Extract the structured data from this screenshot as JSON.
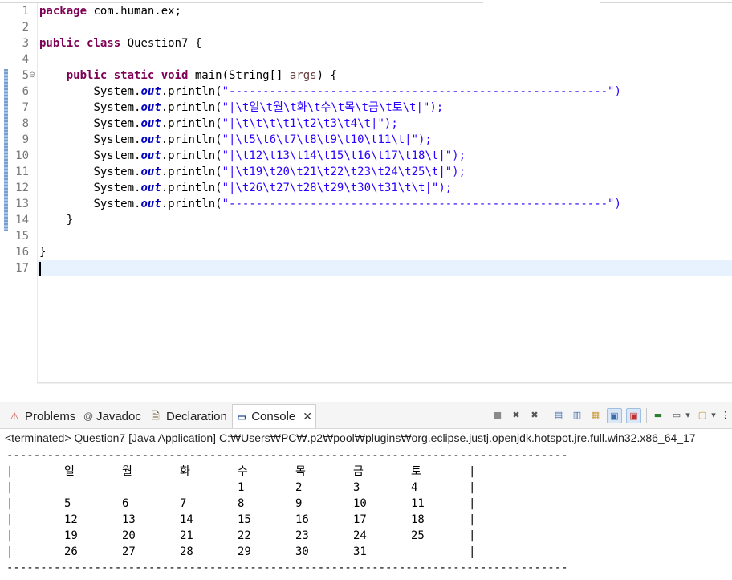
{
  "editor": {
    "line_numbers": [
      "1",
      "2",
      "3",
      "4",
      "5",
      "6",
      "7",
      "8",
      "9",
      "10",
      "11",
      "12",
      "13",
      "14",
      "15",
      "16",
      "17"
    ],
    "fold_marker": "⊖",
    "package_kw": "package",
    "package_name": " com.human.ex;",
    "class_kw": "public class",
    "class_name": " Question7 {",
    "method_kw": "public static void",
    "method_sig": " main(String[] ",
    "method_param": "args",
    "method_end": ") {",
    "sysout_prefix": "System.",
    "sysout_field": "out",
    "sysout_call": ".println(",
    "print_strings": [
      "\"--------------------------------------------------------\")",
      "\"|\\t일\\t월\\t화\\t수\\t목\\t금\\t토\\t|\");",
      "\"|\\t\\t\\t\\t1\\t2\\t3\\t4\\t|\");",
      "\"|\\t5\\t6\\t7\\t8\\t9\\t10\\t11\\t|\");",
      "\"|\\t12\\t13\\t14\\t15\\t16\\t17\\t18\\t|\");",
      "\"|\\t19\\t20\\t21\\t22\\t23\\t24\\t25\\t|\");",
      "\"|\\t26\\t27\\t28\\t29\\t30\\t31\\t\\t|\");",
      "\"--------------------------------------------------------\")"
    ],
    "close_method": "}",
    "close_class": "}"
  },
  "scrollbar": {
    "left_arrow": "<",
    "right_arrow": ">"
  },
  "views": {
    "tabs": [
      {
        "label": "Problems",
        "icon": "problems-icon",
        "glyph": "⚠"
      },
      {
        "label": "Javadoc",
        "icon": "javadoc-icon",
        "glyph": "@"
      },
      {
        "label": "Declaration",
        "icon": "declaration-icon",
        "glyph": "🗎"
      },
      {
        "label": "Console",
        "icon": "console-icon",
        "glyph": "▭"
      }
    ],
    "close_glyph": "✕",
    "status": "<terminated> Question7 [Java Application] C:₩Users₩PC₩.p2₩pool₩plugins₩org.eclipse.justj.openjdk.hotspot.jre.full.win32.x86_64_17"
  },
  "console": {
    "separator": "-----------------------------------------------------------------------------------",
    "bar": "|",
    "rows": [
      [
        "일",
        "월",
        "화",
        "수",
        "목",
        "금",
        "토"
      ],
      [
        "",
        "",
        "",
        "1",
        "2",
        "3",
        "4"
      ],
      [
        "5",
        "6",
        "7",
        "8",
        "9",
        "10",
        "11"
      ],
      [
        "12",
        "13",
        "14",
        "15",
        "16",
        "17",
        "18"
      ],
      [
        "19",
        "20",
        "21",
        "22",
        "23",
        "24",
        "25"
      ],
      [
        "26",
        "27",
        "28",
        "29",
        "30",
        "31",
        ""
      ]
    ]
  },
  "colors": {
    "keyword": "#7f0055",
    "string": "#2a00ff",
    "field": "#0000c0",
    "current_line": "#e8f2fe"
  }
}
